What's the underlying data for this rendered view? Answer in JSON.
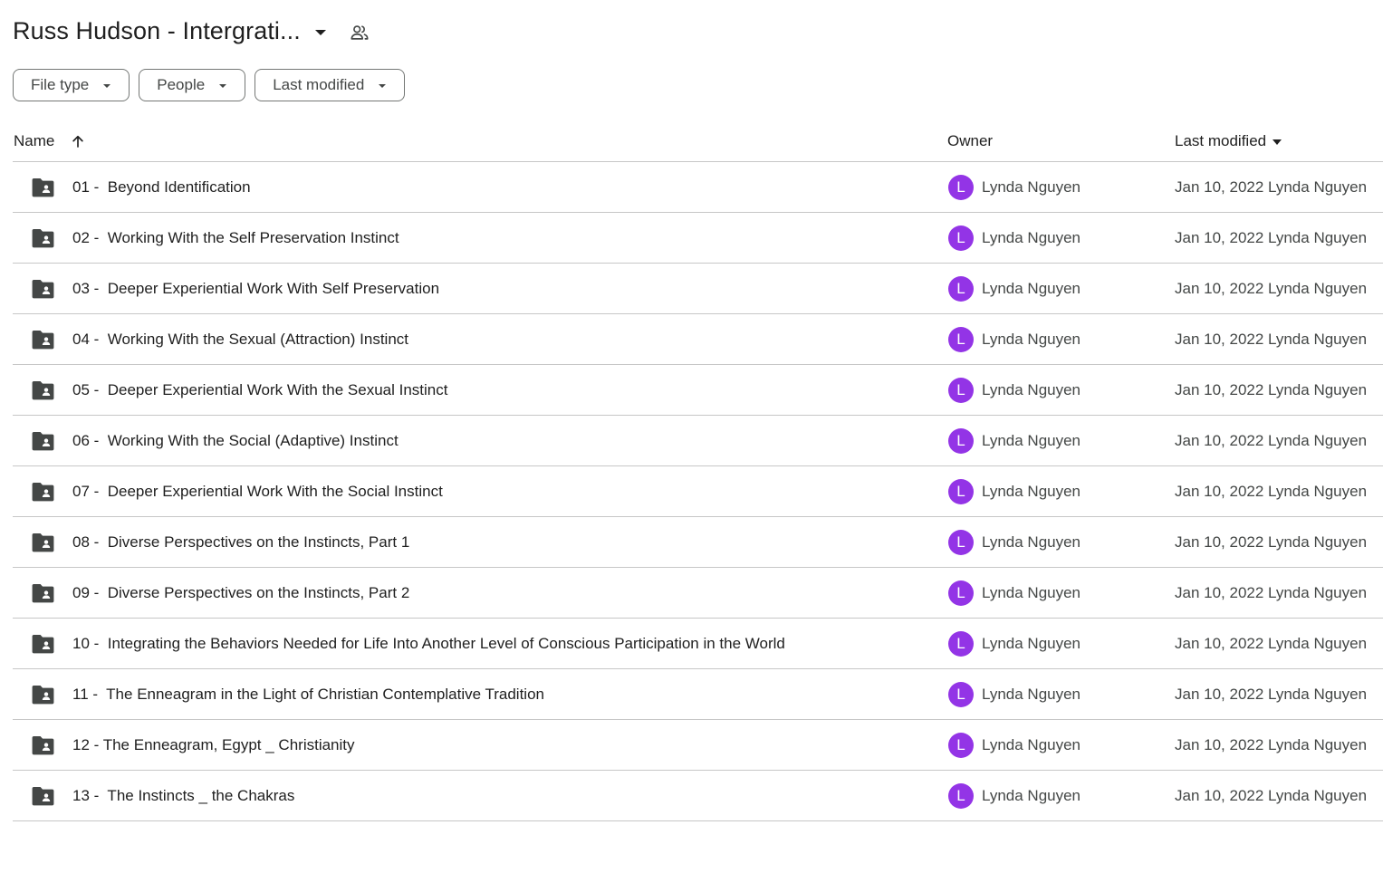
{
  "header": {
    "title": "Russ Hudson - Intergrati...",
    "title_dropdown_icon": "arrow-drop-down-icon",
    "shared_icon": "people-shared-icon"
  },
  "filters": [
    {
      "label": "File type"
    },
    {
      "label": "People"
    },
    {
      "label": "Last modified"
    }
  ],
  "columns": {
    "name": "Name",
    "owner": "Owner",
    "last_modified": "Last modified",
    "sort_icon": "arrow-upward-icon"
  },
  "rows": [
    {
      "name": "01 -  Beyond Identification",
      "owner_initial": "L",
      "owner": "Lynda Nguyen",
      "modified": "Jan 10, 2022 Lynda Nguyen"
    },
    {
      "name": "02 -  Working With the Self Preservation Instinct",
      "owner_initial": "L",
      "owner": "Lynda Nguyen",
      "modified": "Jan 10, 2022 Lynda Nguyen"
    },
    {
      "name": "03 -  Deeper Experiential Work With Self Preservation",
      "owner_initial": "L",
      "owner": "Lynda Nguyen",
      "modified": "Jan 10, 2022 Lynda Nguyen"
    },
    {
      "name": "04 -  Working With the Sexual (Attraction) Instinct",
      "owner_initial": "L",
      "owner": "Lynda Nguyen",
      "modified": "Jan 10, 2022 Lynda Nguyen"
    },
    {
      "name": "05 -  Deeper Experiential Work With the Sexual Instinct",
      "owner_initial": "L",
      "owner": "Lynda Nguyen",
      "modified": "Jan 10, 2022 Lynda Nguyen"
    },
    {
      "name": "06 -  Working With the Social (Adaptive) Instinct",
      "owner_initial": "L",
      "owner": "Lynda Nguyen",
      "modified": "Jan 10, 2022 Lynda Nguyen"
    },
    {
      "name": "07 -  Deeper Experiential Work With the Social Instinct",
      "owner_initial": "L",
      "owner": "Lynda Nguyen",
      "modified": "Jan 10, 2022 Lynda Nguyen"
    },
    {
      "name": "08 -  Diverse Perspectives on the Instincts, Part 1",
      "owner_initial": "L",
      "owner": "Lynda Nguyen",
      "modified": "Jan 10, 2022 Lynda Nguyen"
    },
    {
      "name": "09 -  Diverse Perspectives on the Instincts, Part 2",
      "owner_initial": "L",
      "owner": "Lynda Nguyen",
      "modified": "Jan 10, 2022 Lynda Nguyen"
    },
    {
      "name": "10 -  Integrating the Behaviors Needed for Life Into Another Level of Conscious Participation in the World",
      "owner_initial": "L",
      "owner": "Lynda Nguyen",
      "modified": "Jan 10, 2022 Lynda Nguyen"
    },
    {
      "name": "11 -  The Enneagram in the Light of Christian Contemplative Tradition",
      "owner_initial": "L",
      "owner": "Lynda Nguyen",
      "modified": "Jan 10, 2022 Lynda Nguyen"
    },
    {
      "name": "12 - The Enneagram, Egypt _ Christianity",
      "owner_initial": "L",
      "owner": "Lynda Nguyen",
      "modified": "Jan 10, 2022 Lynda Nguyen"
    },
    {
      "name": "13 -  The Instincts _ the Chakras",
      "owner_initial": "L",
      "owner": "Lynda Nguyen",
      "modified": "Jan 10, 2022 Lynda Nguyen"
    }
  ],
  "row_icon": "shared-folder-icon",
  "colors": {
    "avatar": "#9334e6",
    "text": "#1f1f1f",
    "secondary_text": "#444746",
    "divider": "#c7c7c7"
  }
}
